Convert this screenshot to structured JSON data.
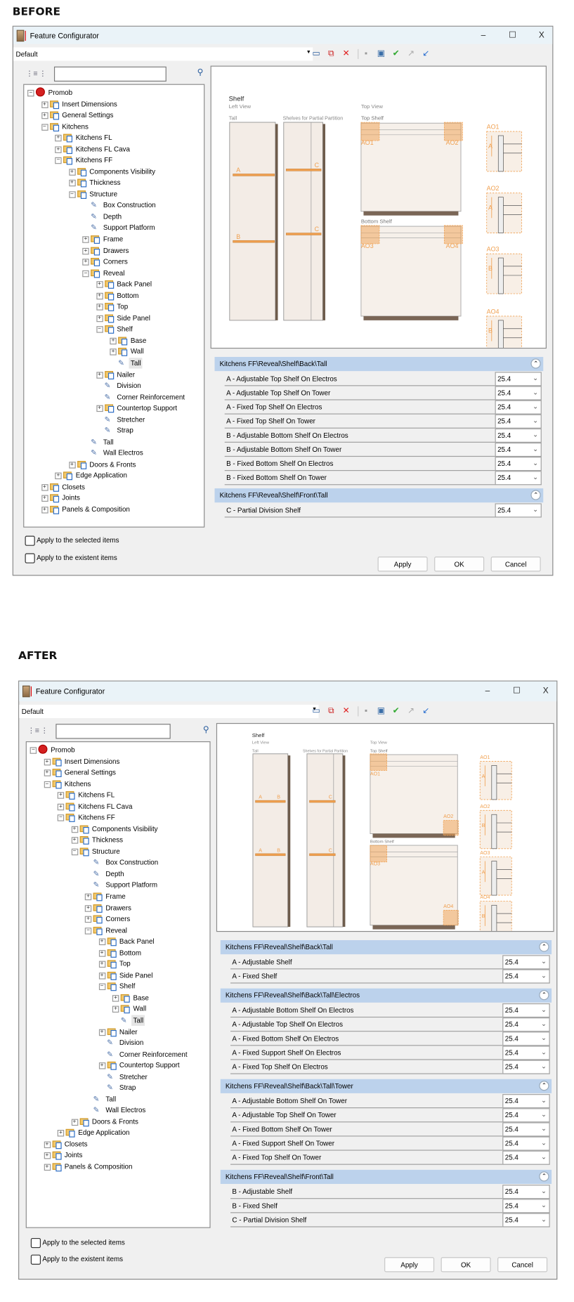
{
  "labels": {
    "before": "BEFORE",
    "after": "AFTER"
  },
  "window": {
    "title": "Feature Configurator",
    "minimize": "–",
    "maximize": "☐",
    "close": "X",
    "preset": "Default",
    "search_value": "",
    "toolbar_icons": [
      "rename-icon",
      "copy-icon",
      "delete-icon",
      "save-icon",
      "save-as-icon",
      "validate-icon",
      "export-icon",
      "import-icon"
    ],
    "checkbox_selected": "Apply to the selected items",
    "checkbox_existent": "Apply to the existent items",
    "apply": "Apply",
    "ok": "OK",
    "cancel": "Cancel"
  },
  "tree": [
    {
      "label": "Promob",
      "level": 0,
      "exp": "-",
      "type": "root"
    },
    {
      "label": "Insert Dimensions",
      "level": 1,
      "exp": "+",
      "type": "folder"
    },
    {
      "label": "General Settings",
      "level": 1,
      "exp": "+",
      "type": "folder"
    },
    {
      "label": "Kitchens",
      "level": 1,
      "exp": "-",
      "type": "folder"
    },
    {
      "label": "Kitchens FL",
      "level": 2,
      "exp": "+",
      "type": "folder"
    },
    {
      "label": "Kitchens FL Cava",
      "level": 2,
      "exp": "+",
      "type": "folder"
    },
    {
      "label": "Kitchens FF",
      "level": 2,
      "exp": "-",
      "type": "folder"
    },
    {
      "label": "Components Visibility",
      "level": 3,
      "exp": "+",
      "type": "folder"
    },
    {
      "label": "Thickness",
      "level": 3,
      "exp": "+",
      "type": "folder"
    },
    {
      "label": "Structure",
      "level": 3,
      "exp": "-",
      "type": "folder"
    },
    {
      "label": "Box Construction",
      "level": 4,
      "exp": "",
      "type": "leaf"
    },
    {
      "label": "Depth",
      "level": 4,
      "exp": "",
      "type": "leaf"
    },
    {
      "label": "Support Platform",
      "level": 4,
      "exp": "",
      "type": "leaf"
    },
    {
      "label": "Frame",
      "level": 4,
      "exp": "+",
      "type": "folder"
    },
    {
      "label": "Drawers",
      "level": 4,
      "exp": "+",
      "type": "folder"
    },
    {
      "label": "Corners",
      "level": 4,
      "exp": "+",
      "type": "folder"
    },
    {
      "label": "Reveal",
      "level": 4,
      "exp": "-",
      "type": "folder"
    },
    {
      "label": "Back Panel",
      "level": 5,
      "exp": "+",
      "type": "folder"
    },
    {
      "label": "Bottom",
      "level": 5,
      "exp": "+",
      "type": "folder"
    },
    {
      "label": "Top",
      "level": 5,
      "exp": "+",
      "type": "folder"
    },
    {
      "label": "Side Panel",
      "level": 5,
      "exp": "+",
      "type": "folder"
    },
    {
      "label": "Shelf",
      "level": 5,
      "exp": "-",
      "type": "folder"
    },
    {
      "label": "Base",
      "level": 6,
      "exp": "+",
      "type": "folder"
    },
    {
      "label": "Wall",
      "level": 6,
      "exp": "+",
      "type": "folder"
    },
    {
      "label": "Tall",
      "level": 6,
      "exp": "",
      "type": "leaf",
      "selected": true
    },
    {
      "label": "Nailer",
      "level": 5,
      "exp": "+",
      "type": "folder"
    },
    {
      "label": "Division",
      "level": 5,
      "exp": "",
      "type": "leaf"
    },
    {
      "label": "Corner Reinforcement",
      "level": 5,
      "exp": "",
      "type": "leaf"
    },
    {
      "label": "Countertop Support",
      "level": 5,
      "exp": "+",
      "type": "folder"
    },
    {
      "label": "Stretcher",
      "level": 5,
      "exp": "",
      "type": "leaf"
    },
    {
      "label": "Strap",
      "level": 5,
      "exp": "",
      "type": "leaf"
    },
    {
      "label": "Tall",
      "level": 4,
      "exp": "",
      "type": "leaf"
    },
    {
      "label": "Wall Electros",
      "level": 4,
      "exp": "",
      "type": "leaf"
    },
    {
      "label": "Doors & Fronts",
      "level": 3,
      "exp": "+",
      "type": "folder"
    },
    {
      "label": "Edge Application",
      "level": 2,
      "exp": "+",
      "type": "folder"
    },
    {
      "label": "Closets",
      "level": 1,
      "exp": "+",
      "type": "folder"
    },
    {
      "label": "Joints",
      "level": 1,
      "exp": "+",
      "type": "folder"
    },
    {
      "label": "Panels & Composition",
      "level": 1,
      "exp": "+",
      "type": "folder"
    }
  ],
  "diagram": {
    "shelf": "Shelf",
    "left_view": "Left View",
    "tall": "Tall",
    "partial": "Shelves for Partial Partition",
    "top_view": "Top View",
    "top_shelf": "Top Shelf",
    "bottom_shelf": "Bottom Shelf",
    "a": "A",
    "b": "B",
    "c": "C",
    "ao1": "AO1",
    "ao2": "AO2",
    "ao3": "AO3",
    "ao4": "AO4",
    "accent": "#f0a050"
  },
  "before": {
    "groups": [
      {
        "title": "Kitchens FF\\Reveal\\Shelf\\Back\\Tall",
        "rows": [
          {
            "label": "A - Adjustable Top Shelf On Electros",
            "value": "25.4"
          },
          {
            "label": "A - Adjustable Top Shelf On Tower",
            "value": "25.4"
          },
          {
            "label": "A - Fixed Top Shelf On Electros",
            "value": "25.4"
          },
          {
            "label": "A - Fixed Top Shelf On Tower",
            "value": "25.4"
          },
          {
            "label": "B - Adjustable Bottom Shelf On Electros",
            "value": "25.4"
          },
          {
            "label": "B - Adjustable Bottom Shelf On Tower",
            "value": "25.4"
          },
          {
            "label": "B - Fixed Bottom Shelf On Electros",
            "value": "25.4"
          },
          {
            "label": "B - Fixed Bottom Shelf On Tower",
            "value": "25.4"
          }
        ]
      },
      {
        "title": "Kitchens FF\\Reveal\\Shelf\\Front\\Tall",
        "rows": [
          {
            "label": "C - Partial Division Shelf",
            "value": "25.4"
          }
        ]
      }
    ]
  },
  "after": {
    "groups": [
      {
        "title": "Kitchens FF\\Reveal\\Shelf\\Back\\Tall",
        "rows": [
          {
            "label": "A - Adjustable Shelf",
            "value": "25.4"
          },
          {
            "label": "A - Fixed Shelf",
            "value": "25.4"
          }
        ]
      },
      {
        "title": "Kitchens FF\\Reveal\\Shelf\\Back\\Tall\\Electros",
        "rows": [
          {
            "label": "A - Adjustable Bottom Shelf On Electros",
            "value": "25.4"
          },
          {
            "label": "A - Adjustable Top Shelf On Electros",
            "value": "25.4"
          },
          {
            "label": "A - Fixed Bottom Shelf On Electros",
            "value": "25.4"
          },
          {
            "label": "A - Fixed Support Shelf On Electros",
            "value": "25.4"
          },
          {
            "label": "A - Fixed Top Shelf On Electros",
            "value": "25.4"
          }
        ]
      },
      {
        "title": "Kitchens FF\\Reveal\\Shelf\\Back\\Tall\\Tower",
        "rows": [
          {
            "label": "A - Adjustable Bottom Shelf On Tower",
            "value": "25.4"
          },
          {
            "label": "A - Adjustable Top Shelf On Tower",
            "value": "25.4"
          },
          {
            "label": "A - Fixed Bottom Shelf On Tower",
            "value": "25.4"
          },
          {
            "label": "A - Fixed Support Shelf On Tower",
            "value": "25.4"
          },
          {
            "label": "A - Fixed Top Shelf On Tower",
            "value": "25.4"
          }
        ]
      },
      {
        "title": "Kitchens FF\\Reveal\\Shelf\\Front\\Tall",
        "rows": [
          {
            "label": "B - Adjustable Shelf",
            "value": "25.4"
          },
          {
            "label": "B - Fixed Shelf",
            "value": "25.4"
          },
          {
            "label": "C - Partial Division Shelf",
            "value": "25.4"
          }
        ]
      }
    ]
  }
}
